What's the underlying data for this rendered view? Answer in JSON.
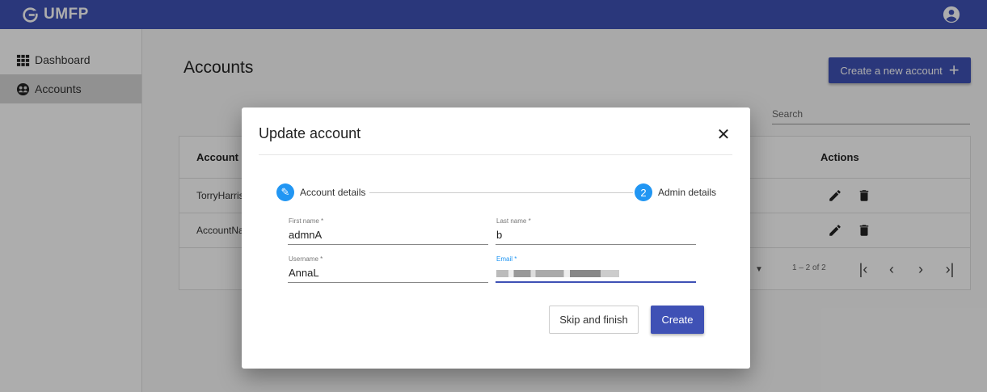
{
  "app": {
    "title": "UMFP"
  },
  "sidebar": {
    "items": [
      {
        "label": "Dashboard",
        "icon": "grid-icon",
        "active": false
      },
      {
        "label": "Accounts",
        "icon": "accounts-icon",
        "active": true
      }
    ]
  },
  "page": {
    "title": "Accounts",
    "create_button": "Create a new account",
    "search_placeholder": "Search"
  },
  "table": {
    "headers": {
      "account_name": "Account n",
      "actions": "Actions"
    },
    "rows": [
      {
        "account_name": "TorryHarris"
      },
      {
        "account_name": "AccountNa"
      }
    ],
    "pager": {
      "range": "1 – 2 of 2"
    }
  },
  "dialog": {
    "title": "Update account",
    "close_symbol": "✕",
    "steps": [
      {
        "label": "Account details",
        "marker": "✎"
      },
      {
        "label": "Admin details",
        "marker": "2"
      }
    ],
    "fields": {
      "first_name": {
        "label": "First name *",
        "value": "admnA"
      },
      "last_name": {
        "label": "Last name *",
        "value": "b"
      },
      "username": {
        "label": "Username *",
        "value": "AnnaL"
      },
      "email": {
        "label": "Email *",
        "value": ""
      }
    },
    "buttons": {
      "skip": "Skip and finish",
      "create": "Create"
    }
  },
  "colors": {
    "primary": "#3f51b5",
    "step_accent": "#2196f3"
  }
}
